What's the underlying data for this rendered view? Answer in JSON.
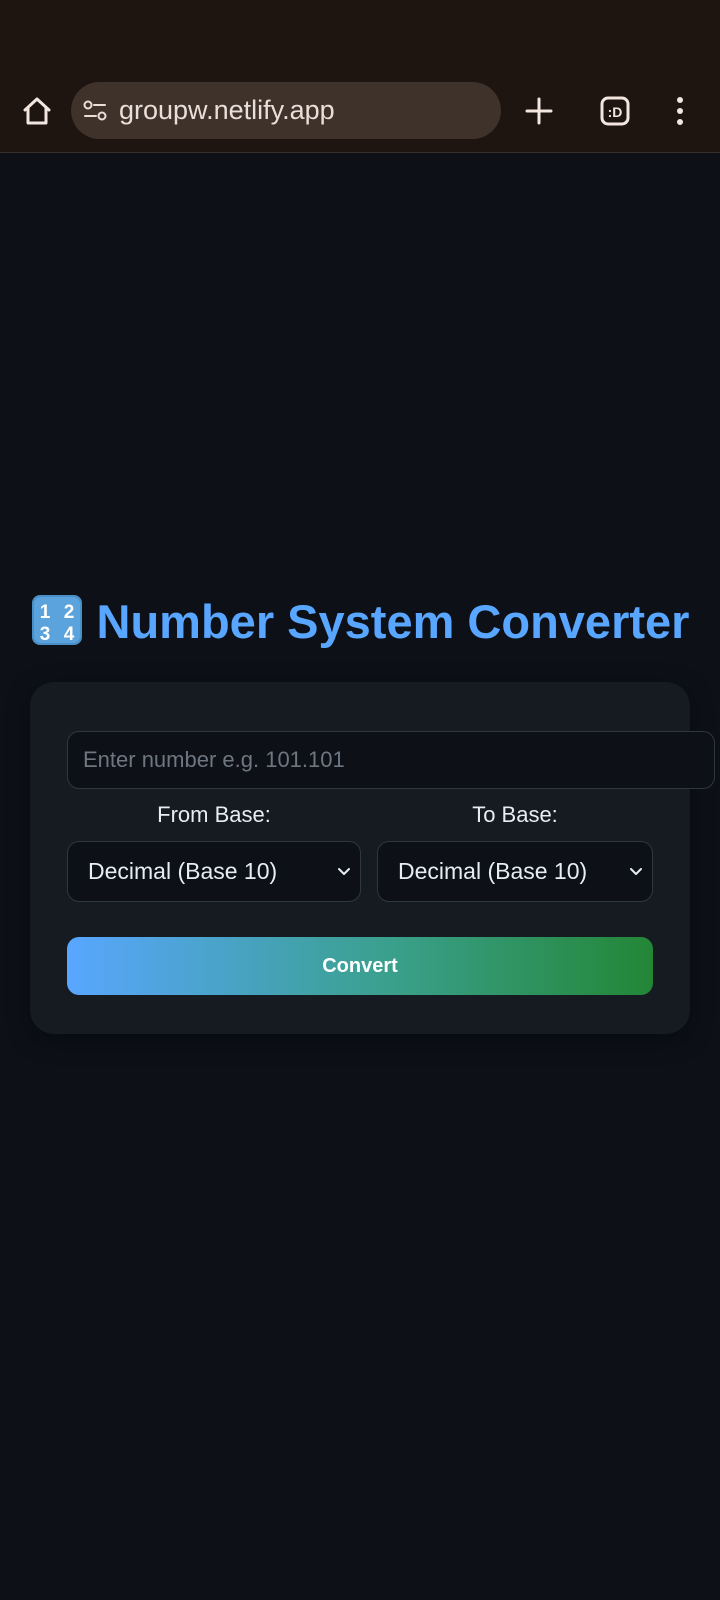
{
  "browser": {
    "url": "groupw.netlify.app",
    "icons": [
      "home-icon",
      "site-info-icon",
      "plus-icon",
      "tab-switcher-icon",
      "more-vert-icon"
    ]
  },
  "app": {
    "title_icon": "input-numbers-icon",
    "title": "Number System Converter",
    "accent_color": "#58a6ff",
    "input": {
      "placeholder": "Enter number e.g. 101.101",
      "value": ""
    },
    "from_label": "From Base:",
    "to_label": "To Base:",
    "from_selected": "Decimal (Base 10)",
    "to_selected": "Decimal (Base 10)",
    "convert_label": "Convert",
    "button_gradient": [
      "#58a6ff",
      "#238636"
    ]
  }
}
